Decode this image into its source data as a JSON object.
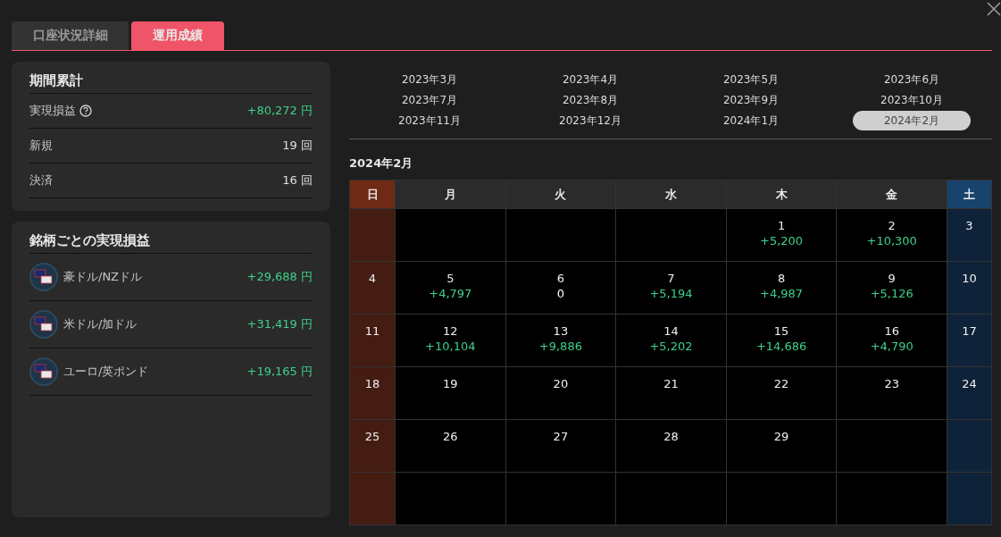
{
  "tabs": [
    {
      "label": "口座状況詳細",
      "selected": false
    },
    {
      "label": "運用成績",
      "selected": true
    }
  ],
  "period_summary": {
    "title": "期間累計",
    "rows": [
      {
        "label": "実現損益",
        "help": true,
        "value": "+80,272",
        "unit": "円",
        "kind": "gain"
      },
      {
        "label": "新規",
        "help": false,
        "value": "19",
        "unit": "回",
        "kind": "count"
      },
      {
        "label": "決済",
        "help": false,
        "value": "16",
        "unit": "回",
        "kind": "count"
      }
    ]
  },
  "by_symbol": {
    "title": "銘柄ごとの実現損益",
    "rows": [
      {
        "name": "豪ドル/NZドル",
        "value": "+29,688",
        "unit": "円"
      },
      {
        "name": "米ドル/加ドル",
        "value": "+31,419",
        "unit": "円"
      },
      {
        "name": "ユーロ/英ポンド",
        "value": "+19,165",
        "unit": "円"
      }
    ]
  },
  "months": [
    {
      "label": "2023年3月",
      "selected": false
    },
    {
      "label": "2023年4月",
      "selected": false
    },
    {
      "label": "2023年5月",
      "selected": false
    },
    {
      "label": "2023年6月",
      "selected": false
    },
    {
      "label": "2023年7月",
      "selected": false
    },
    {
      "label": "2023年8月",
      "selected": false
    },
    {
      "label": "2023年9月",
      "selected": false
    },
    {
      "label": "2023年10月",
      "selected": false
    },
    {
      "label": "2023年11月",
      "selected": false
    },
    {
      "label": "2023年12月",
      "selected": false
    },
    {
      "label": "2024年1月",
      "selected": false
    },
    {
      "label": "2024年2月",
      "selected": true
    }
  ],
  "calendar": {
    "title": "2024年2月",
    "weekdays": [
      "日",
      "月",
      "火",
      "水",
      "木",
      "金",
      "土"
    ],
    "weeks": [
      [
        {
          "kind": "blank"
        },
        {
          "kind": "blank"
        },
        {
          "kind": "blank"
        },
        {
          "kind": "blank"
        },
        {
          "day": "1",
          "pnl": "+5,200",
          "kind": "gain"
        },
        {
          "day": "2",
          "pnl": "+10,300",
          "kind": "gain"
        },
        {
          "day": "3"
        }
      ],
      [
        {
          "day": "4"
        },
        {
          "day": "5",
          "pnl": "+4,797",
          "kind": "gain"
        },
        {
          "day": "6",
          "pnl": "0",
          "kind": "flat"
        },
        {
          "day": "7",
          "pnl": "+5,194",
          "kind": "gain"
        },
        {
          "day": "8",
          "pnl": "+4,987",
          "kind": "gain"
        },
        {
          "day": "9",
          "pnl": "+5,126",
          "kind": "gain"
        },
        {
          "day": "10"
        }
      ],
      [
        {
          "day": "11"
        },
        {
          "day": "12",
          "pnl": "+10,104",
          "kind": "gain"
        },
        {
          "day": "13",
          "pnl": "+9,886",
          "kind": "gain"
        },
        {
          "day": "14",
          "pnl": "+5,202",
          "kind": "gain"
        },
        {
          "day": "15",
          "pnl": "+14,686",
          "kind": "gain"
        },
        {
          "day": "16",
          "pnl": "+4,790",
          "kind": "gain"
        },
        {
          "day": "17"
        }
      ],
      [
        {
          "day": "18"
        },
        {
          "day": "19"
        },
        {
          "day": "20"
        },
        {
          "day": "21"
        },
        {
          "day": "22"
        },
        {
          "day": "23"
        },
        {
          "day": "24"
        }
      ],
      [
        {
          "day": "25"
        },
        {
          "day": "26"
        },
        {
          "day": "27"
        },
        {
          "day": "28"
        },
        {
          "day": "29"
        },
        {
          "kind": "blank"
        },
        {
          "kind": "blank"
        }
      ],
      [
        {
          "kind": "blank"
        },
        {
          "kind": "blank"
        },
        {
          "kind": "blank"
        },
        {
          "kind": "blank"
        },
        {
          "kind": "blank"
        },
        {
          "kind": "blank"
        },
        {
          "kind": "blank"
        }
      ]
    ]
  }
}
